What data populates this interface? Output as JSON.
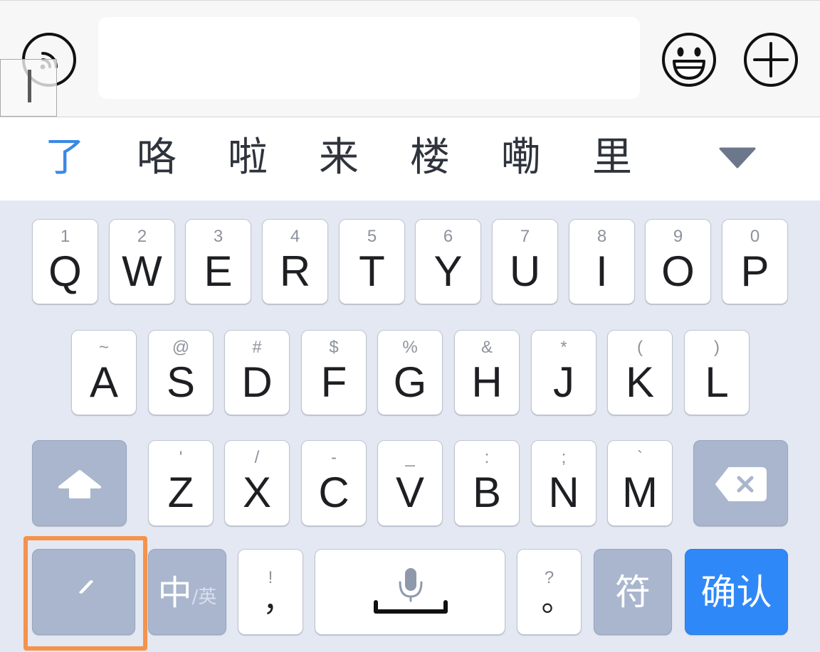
{
  "input_bar": {
    "voice_icon": "voice-wave-icon",
    "emoji_icon": "smiley-face-icon",
    "add_icon": "plus-circle-icon",
    "cursor_icon": "text-cursor-icon"
  },
  "candidates": {
    "items": [
      "了",
      "咯",
      "啦",
      "来",
      "楼",
      "嘞",
      "里"
    ],
    "expand_icon": "triangle-down-icon"
  },
  "keyboard": {
    "row1": [
      {
        "hint": "1",
        "letter": "Q"
      },
      {
        "hint": "2",
        "letter": "W"
      },
      {
        "hint": "3",
        "letter": "E"
      },
      {
        "hint": "4",
        "letter": "R"
      },
      {
        "hint": "5",
        "letter": "T"
      },
      {
        "hint": "6",
        "letter": "Y"
      },
      {
        "hint": "7",
        "letter": "U"
      },
      {
        "hint": "8",
        "letter": "I"
      },
      {
        "hint": "9",
        "letter": "O"
      },
      {
        "hint": "0",
        "letter": "P"
      }
    ],
    "row2": [
      {
        "hint": "~",
        "letter": "A"
      },
      {
        "hint": "@",
        "letter": "S"
      },
      {
        "hint": "#",
        "letter": "D"
      },
      {
        "hint": "$",
        "letter": "F"
      },
      {
        "hint": "%",
        "letter": "G"
      },
      {
        "hint": "&",
        "letter": "H"
      },
      {
        "hint": "*",
        "letter": "J"
      },
      {
        "hint": "(",
        "letter": "K"
      },
      {
        "hint": ")",
        "letter": "L"
      }
    ],
    "row3": [
      {
        "hint": "'",
        "letter": "Z"
      },
      {
        "hint": "/",
        "letter": "X"
      },
      {
        "hint": "-",
        "letter": "C"
      },
      {
        "hint": "_",
        "letter": "V"
      },
      {
        "hint": ":",
        "letter": "B"
      },
      {
        "hint": ";",
        "letter": "N"
      },
      {
        "hint": "`",
        "letter": "M"
      }
    ],
    "shift_icon": "shift-arrow-icon",
    "delete_icon": "backspace-icon",
    "bottom_row": {
      "stroke_icon": "pen-stroke-icon",
      "lang_main": "中",
      "lang_sub": "/英",
      "comma_hint": "!",
      "comma": "，",
      "space_icon": "microphone-icon",
      "period_hint": "?",
      "period": "。",
      "symbols": "符",
      "confirm": "确认"
    }
  },
  "colors": {
    "keyboard_bg": "#e4e8f2",
    "function_key_bg": "#a9b6ce",
    "confirm_bg": "#2f88f7",
    "active_candidate": "#3b88e4",
    "highlight_border": "#f5924b"
  }
}
